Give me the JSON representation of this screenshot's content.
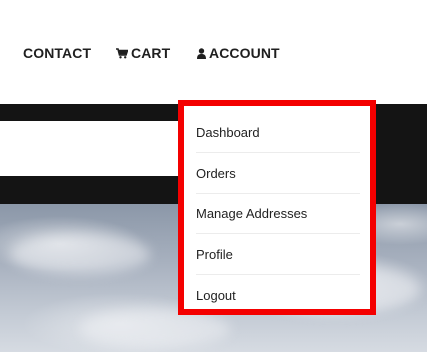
{
  "nav": {
    "contact": "CONTACT",
    "cart": "CART",
    "account": "ACCOUNT",
    "cart_icon": "cart-icon",
    "account_icon": "user-icon"
  },
  "account_menu": {
    "items": [
      {
        "label": "Dashboard"
      },
      {
        "label": "Orders"
      },
      {
        "label": "Manage Addresses"
      },
      {
        "label": "Profile"
      },
      {
        "label": "Logout"
      }
    ]
  },
  "colors": {
    "highlight": "#f40000",
    "nav_text": "#1f1f1f",
    "band": "#141414"
  }
}
